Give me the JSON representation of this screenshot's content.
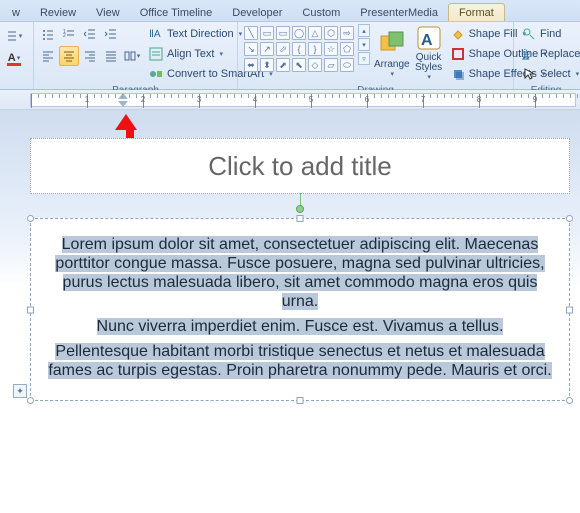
{
  "tabs": {
    "t0": "w",
    "t1": "Review",
    "t2": "View",
    "t3": "Office Timeline",
    "t4": "Developer",
    "t5": "Custom",
    "t6": "PresenterMedia",
    "t7": "Format"
  },
  "ribbon": {
    "paragraph": {
      "label": "Paragraph",
      "text_direction": "Text Direction",
      "align_text": "Align Text",
      "convert": "Convert to SmartArt"
    },
    "drawing": {
      "label": "Drawing",
      "arrange": "Arrange",
      "quick_styles": "Quick\nStyles",
      "shape_fill": "Shape Fill",
      "shape_outline": "Shape Outline",
      "shape_effects": "Shape Effects"
    },
    "editing": {
      "label": "Editing",
      "find": "Find",
      "replace": "Replace",
      "select": "Select"
    }
  },
  "ruler": {
    "marks": [
      "1",
      "2",
      "3",
      "4",
      "5",
      "6",
      "7",
      "8",
      "9"
    ]
  },
  "slide": {
    "title_placeholder": "Click to add title",
    "paragraphs": [
      "Lorem ipsum dolor sit amet, consectetuer adipiscing elit. Maecenas porttitor congue massa. Fusce posuere, magna sed pulvinar ultricies, purus lectus malesuada libero, sit amet commodo magna eros quis urna.",
      "Nunc viverra imperdiet enim. Fusce est. Vivamus a tellus.",
      "Pellentesque habitant morbi tristique senectus et netus et malesuada fames ac turpis egestas. Proin pharetra nonummy pede. Mauris et orci."
    ]
  },
  "font_letter": "A"
}
